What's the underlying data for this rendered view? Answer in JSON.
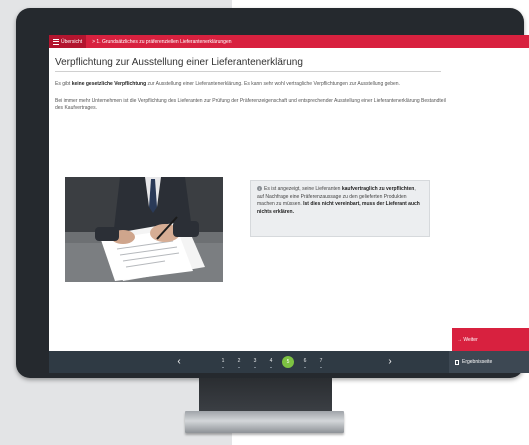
{
  "nav": {
    "menu_label": "Übersicht",
    "breadcrumb": "> 1. Grundsätzliches zu präferenziellen Lieferantenerklärungen"
  },
  "main": {
    "title": "Verpflichtung zur Ausstellung einer Lieferantenerklärung",
    "para1_pre": "Es gibt ",
    "para1_bold": "keine gesetzliche Verpflichtung",
    "para1_post": " zur Ausstellung einer Lieferantenerklärung. Es kann sehr wohl vertragliche Verpflichtungen zur Ausstellung geben.",
    "para2": "Bei immer mehr Unternehmen ist die Verpflichtung des Lieferanten zur Prüfung der Präferenzeigenschaft und entsprechender Ausstellung einer Lieferantenerklärung Bestandteil des Kaufvertrages."
  },
  "info": {
    "pre": "Es ist angezeigt, seine Lieferanten ",
    "bold1": "kaufvertraglich zu verpflichten",
    "mid": ", auf Nachfrage eine Präferenzaussage zu den gelieferten Produkten machen zu müssen. ",
    "bold2": "Ist dies nicht vereinbart, muss der Lieferant auch nichts erklären."
  },
  "footer": {
    "next_label": "→ Weiter",
    "results_label": "Ergebnisseite",
    "prev_arrow": "‹",
    "next_arrow": "›",
    "pages": [
      "1",
      "2",
      "3",
      "4",
      "5",
      "6",
      "7"
    ],
    "active_page": "5"
  },
  "icons": {
    "menu": "hamburger-icon",
    "info": "info-icon",
    "results": "document-icon"
  },
  "colors": {
    "accent": "#d8213f",
    "bar": "#2f3a44",
    "active_page": "#7dc242",
    "monitor": "#25292e"
  }
}
